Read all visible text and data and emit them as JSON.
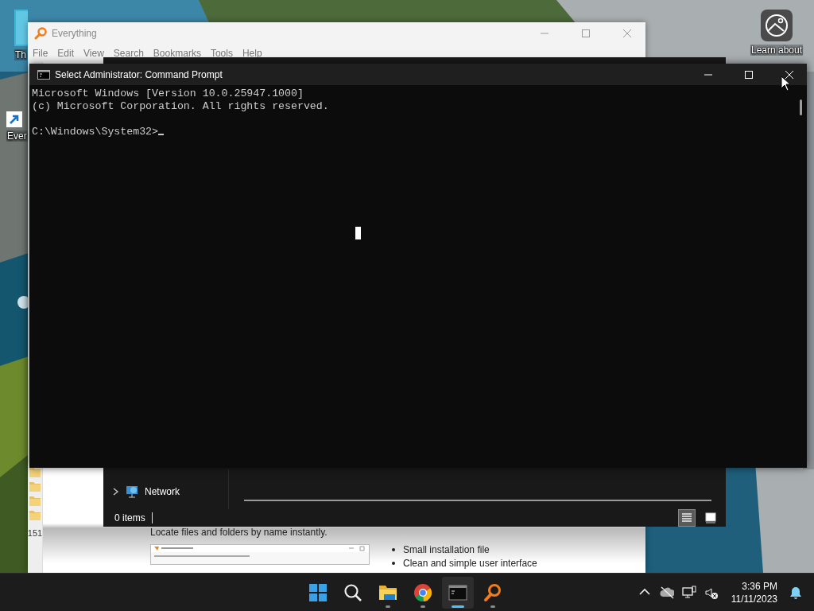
{
  "desktop": {
    "icons": [
      {
        "kind": "app",
        "label": "Th"
      },
      {
        "kind": "shortcut",
        "label": "Ever"
      },
      {
        "kind": "spotlight",
        "label": "Learn about"
      }
    ]
  },
  "everything_window": {
    "title": "Everything",
    "menu": [
      "File",
      "Edit",
      "View",
      "Search",
      "Bookmarks",
      "Tools",
      "Help"
    ],
    "side_count": "151",
    "page": {
      "tagline": "Locate files and folders by name instantly.",
      "bullets": [
        "Small installation file",
        "Clean and simple user interface"
      ]
    }
  },
  "explorer_window": {
    "nav_item": "Network",
    "status": "0 items",
    "views": [
      {
        "kind": "details",
        "selected": true
      },
      {
        "kind": "thumbnails",
        "selected": false
      }
    ]
  },
  "command_prompt": {
    "title": "Select Administrator: Command Prompt",
    "lines": [
      "Microsoft Windows [Version 10.0.25947.1000]",
      "(c) Microsoft Corporation. All rights reserved."
    ],
    "prompt": "C:\\Windows\\System32>"
  },
  "taskbar": {
    "apps": [
      {
        "kind": "start",
        "running": false,
        "active": false
      },
      {
        "kind": "search",
        "running": false,
        "active": false
      },
      {
        "kind": "files",
        "running": true,
        "active": false
      },
      {
        "kind": "browser",
        "running": true,
        "active": false
      },
      {
        "kind": "terminal",
        "running": true,
        "active": true
      },
      {
        "kind": "everything",
        "running": true,
        "active": false
      }
    ],
    "tray": [
      {
        "kind": "chevron"
      },
      {
        "kind": "cloud-off"
      },
      {
        "kind": "network"
      },
      {
        "kind": "volume-muted"
      }
    ],
    "time": "3:36 PM",
    "date": "11/11/2023"
  }
}
